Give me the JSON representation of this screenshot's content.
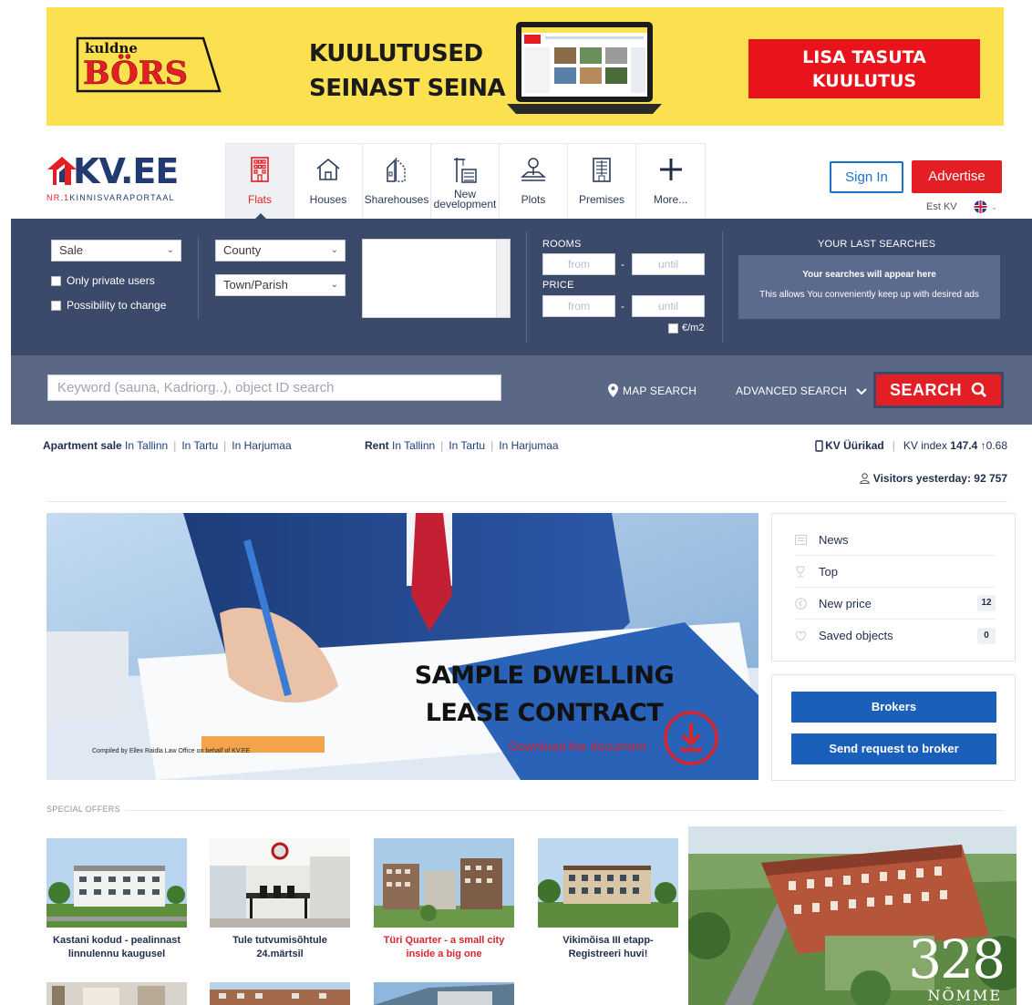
{
  "banner": {
    "logo_top": "kuldne",
    "logo_main": "BÖRS",
    "headline_1": "KUULUTUSED",
    "headline_2": "SEINAST SEINA",
    "cta_1": "LISA TASUTA",
    "cta_2": "KUULUTUS"
  },
  "logo": {
    "name": "KV.EE",
    "tagline_prefix": "NR.1",
    "tagline": "KINNISVARAPORTAAL"
  },
  "categories": [
    {
      "label": "Flats",
      "icon": "building-grid-icon",
      "active": true
    },
    {
      "label": "Houses",
      "icon": "house-icon"
    },
    {
      "label": "Sharehouses",
      "icon": "sharehouse-icon"
    },
    {
      "label": "New development",
      "icon": "crane-icon"
    },
    {
      "label": "Plots",
      "icon": "plot-tree-icon"
    },
    {
      "label": "Premises",
      "icon": "office-building-icon"
    },
    {
      "label": "More...",
      "icon": "plus-icon"
    }
  ],
  "header": {
    "signin": "Sign In",
    "advertise": "Advertise",
    "lang": "Est KV"
  },
  "search": {
    "deal_type": "Sale",
    "county": "County",
    "town": "Town/Parish",
    "only_private": "Only private users",
    "possibility_change": "Possibility to change",
    "rooms_label": "ROOMS",
    "price_label": "PRICE",
    "from": "from",
    "until": "until",
    "dash": "-",
    "per_m2": "€/m2",
    "last_title": "YOUR LAST SEARCHES",
    "last_line1": "Your searches will appear here",
    "last_line2": "This allows You conveniently keep up with desired ads",
    "keyword_placeholder": "Keyword (sauna, Kadriorg..), object ID search",
    "map_search": "MAP SEARCH",
    "advanced_search": "ADVANCED SEARCH",
    "search_button": "SEARCH"
  },
  "quick": {
    "sale_label": "Apartment sale",
    "rent_label": "Rent",
    "in_tallinn": "In Tallinn",
    "in_tartu": "In Tartu",
    "in_harjumaa": "In Harjumaa",
    "sep": "|",
    "kv_rent": "KV Üürikad",
    "kv_index_label": "KV index",
    "kv_index_value": "147.4",
    "kv_index_change": "0.68",
    "visitors": "Visitors yesterday: 92 757"
  },
  "hero": {
    "title_1": "SAMPLE DWELLING",
    "title_2": "LEASE CONTRACT",
    "link": "Download the document",
    "credit": "Compiled by Ellex Raidla Law Office on behalf of KV.EE"
  },
  "side": {
    "items": [
      {
        "label": "News",
        "icon": "news-icon",
        "count": ""
      },
      {
        "label": "Top",
        "icon": "trophy-icon",
        "count": ""
      },
      {
        "label": "New price",
        "icon": "euro-icon",
        "count": "12"
      },
      {
        "label": "Saved objects",
        "icon": "heart-icon",
        "count": "0"
      }
    ],
    "brokers": "Brokers",
    "send_request": "Send request to broker"
  },
  "offers": {
    "title": "SPECIAL OFFERS",
    "items": [
      {
        "caption_1": "Kastani kodud - pealinnast",
        "caption_2": "linnulennu kaugusel"
      },
      {
        "caption_1": "Tule tutvumisõhtule",
        "caption_2": "24.märtsil"
      },
      {
        "caption_1": "Türi Quarter - a small city",
        "caption_2": "inside a big one"
      },
      {
        "caption_1": "Vikimõisa III etapp-",
        "caption_2": "Registreeri huvi!"
      }
    ],
    "big_ad_number": "328",
    "big_ad_sub": "NÕMME"
  }
}
